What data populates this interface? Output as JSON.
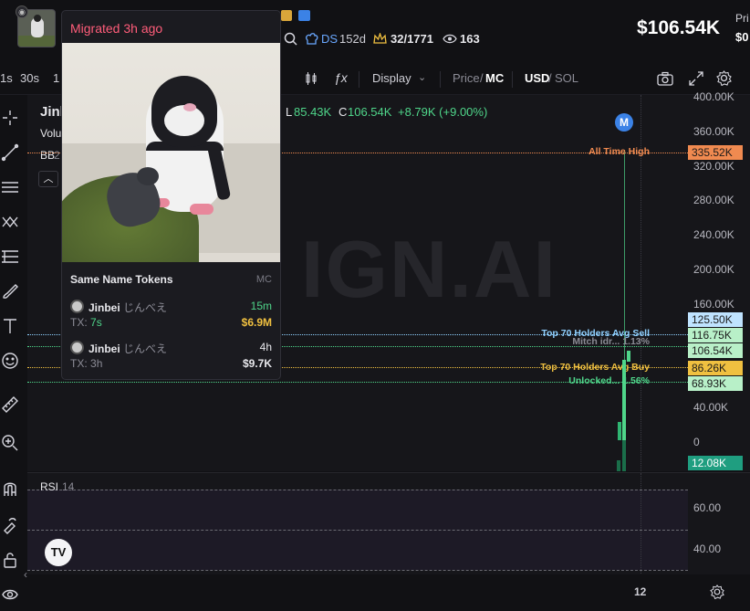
{
  "header": {
    "verified_icon": "check-badge-icon",
    "ds_label": "DS",
    "ds_age": "152d",
    "holders": "32/1771",
    "views": "163",
    "mc_value": "$106.54K",
    "price_label": "Pri",
    "price_value": "$0"
  },
  "toolbar": {
    "intervals": [
      "1s",
      "30s",
      "1"
    ],
    "display_label": "Display",
    "price_label": "Price",
    "mc_label": "MC",
    "usd_label": "USD",
    "sol_label": "SOL"
  },
  "legend": {
    "title": "Jinbei",
    "volume_label": "Volu",
    "bb_label": "BB",
    "bb_period": "2",
    "low_label": "L",
    "low_value": "85.43K",
    "close_label": "C",
    "close_value": "106.54K",
    "change": "+8.79K (+9.00%)"
  },
  "watermark": "IGN.AI",
  "marker_label": "M",
  "levels": [
    {
      "label": "All Time High",
      "tag": "335.52K",
      "color": "#f08a50"
    },
    {
      "label": "Top 70 Holders Avg Sell",
      "tag": "125.50K",
      "color": "#8fd0ff"
    },
    {
      "label": "Mitch idr... 1.13%",
      "tag": "116.75K",
      "color": "#4fd68a"
    },
    {
      "label": "",
      "tag": "106.54K",
      "color": "#4fd68a"
    },
    {
      "label": "Top 70 Holders Avg Buy",
      "tag": "86.26K",
      "color": "#f0c040"
    },
    {
      "label": "Unlocked... 1.56%",
      "tag": "68.93K",
      "color": "#4fd68a"
    },
    {
      "label": "",
      "tag": "12.08K",
      "color": "#1f9e80"
    }
  ],
  "y_ticks": [
    "400.00K",
    "360.00K",
    "320.00K",
    "280.00K",
    "240.00K",
    "200.00K",
    "160.00K",
    "40.00K",
    "0"
  ],
  "rsi": {
    "label": "RSI",
    "period": "14",
    "ticks": [
      "60.00",
      "40.00"
    ]
  },
  "x_axis": {
    "tick": "12"
  },
  "popup": {
    "title": "Migrated 3h ago",
    "section_title": "Same Name Tokens",
    "section_mc": "MC",
    "tokens": [
      {
        "name": "Jinbei",
        "jp_name": "じんべえ",
        "age": "15m",
        "tx_label": "TX:",
        "tx": "7s",
        "mc": "$6.9M"
      },
      {
        "name": "Jinbei",
        "jp_name": "じんべえ",
        "age": "4h",
        "tx_label": "TX:",
        "tx": "3h",
        "mc": "$9.7K"
      }
    ]
  },
  "tradingview_logo": "TV"
}
